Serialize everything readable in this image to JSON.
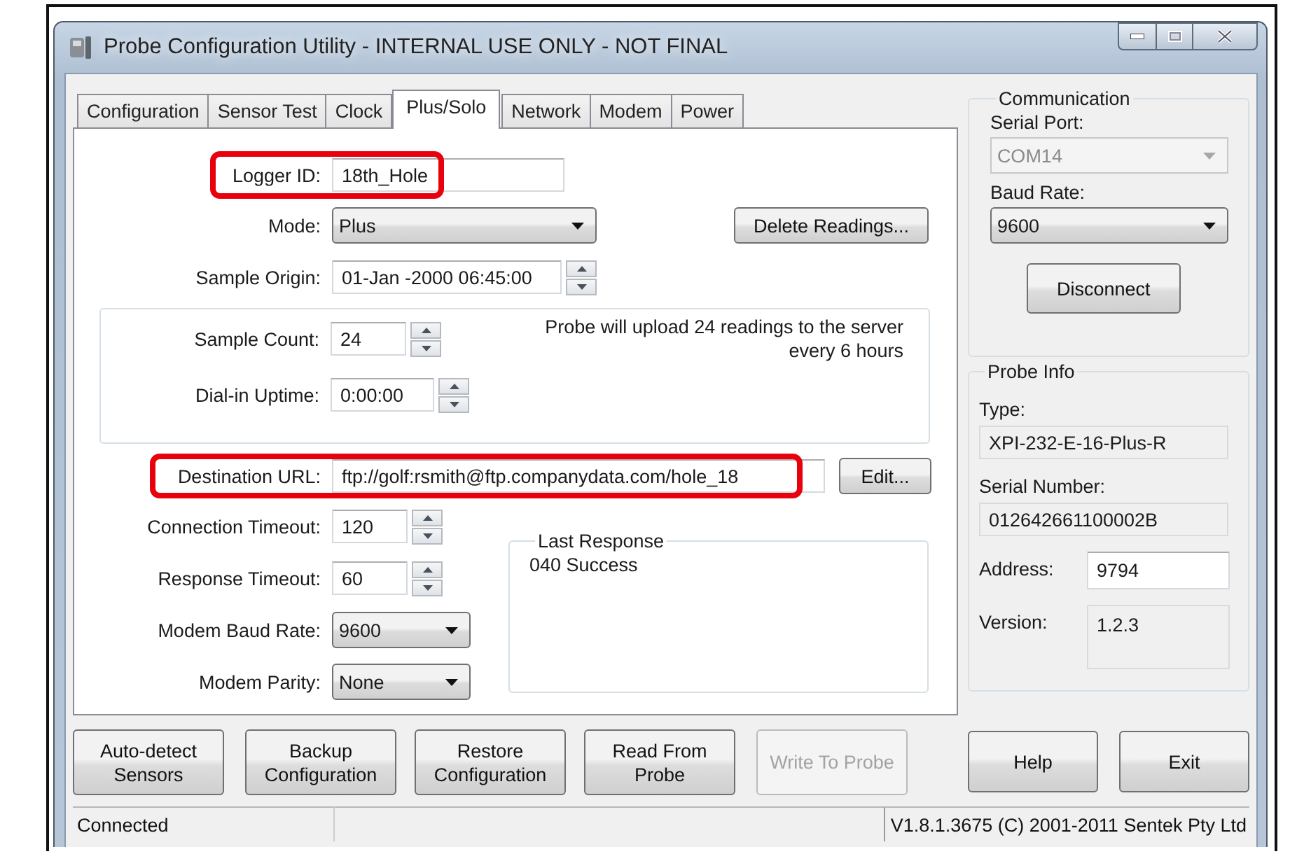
{
  "window": {
    "title": "Probe Configuration Utility - INTERNAL USE ONLY - NOT FINAL"
  },
  "tabs": [
    {
      "label": "Configuration",
      "selected": false
    },
    {
      "label": "Sensor Test",
      "selected": false
    },
    {
      "label": "Clock",
      "selected": false
    },
    {
      "label": "Plus/Solo",
      "selected": true
    },
    {
      "label": "Network",
      "selected": false
    },
    {
      "label": "Modem",
      "selected": false
    },
    {
      "label": "Power",
      "selected": false
    }
  ],
  "plus_solo": {
    "logger_id": {
      "label": "Logger ID:",
      "value": "18th_Hole",
      "highlighted": true
    },
    "mode": {
      "label": "Mode:",
      "value": "Plus"
    },
    "delete_button": "Delete Readings...",
    "sample_origin": {
      "label": "Sample Origin:",
      "value": "01-Jan -2000 06:45:00"
    },
    "sample_count": {
      "label": "Sample Count:",
      "value": "24"
    },
    "dial_in_uptime": {
      "label": "Dial-in Uptime:",
      "value": "0:00:00"
    },
    "upload_note": "Probe will upload 24 readings to the server\nevery 6 hours",
    "destination_url": {
      "label": "Destination URL:",
      "value": "ftp://golf:rsmith@ftp.companydata.com/hole_18",
      "highlighted": true
    },
    "edit_button": "Edit...",
    "modem_settings": [
      {
        "kind": "spin",
        "label": "Connection Timeout:",
        "value": "120"
      },
      {
        "kind": "spin",
        "label": "Response Timeout:",
        "value": "60"
      },
      {
        "kind": "dropdown",
        "label": "Modem Baud Rate:",
        "value": "9600"
      },
      {
        "kind": "dropdown",
        "label": "Modem Parity:",
        "value": "None"
      }
    ],
    "last_response": {
      "title": "Last Response",
      "text": "040 Success"
    }
  },
  "communication": {
    "title": "Communication",
    "serial_port": {
      "label": "Serial Port:",
      "value": "COM14",
      "disabled": true
    },
    "baud_rate": {
      "label": "Baud Rate:",
      "value": "9600",
      "disabled": false
    },
    "disconnect_button": "Disconnect"
  },
  "probe_info": {
    "title": "Probe Info",
    "fields": [
      {
        "kind": "stacked",
        "label": "Type:",
        "value": "XPI-232-E-16-Plus-R",
        "editable": false
      },
      {
        "kind": "stacked",
        "label": "Serial Number:",
        "value": "012642661100002B",
        "editable": false
      },
      {
        "kind": "inline",
        "label": "Address:",
        "value": "9794",
        "editable": true
      },
      {
        "kind": "inline_tall",
        "label": "Version:",
        "value": "1.2.3",
        "editable": false
      }
    ]
  },
  "action_buttons": [
    {
      "label": "Auto-detect\nSensors",
      "disabled": false
    },
    {
      "label": "Backup\nConfiguration",
      "disabled": false
    },
    {
      "label": "Restore\nConfiguration",
      "disabled": false
    },
    {
      "label": "Read From\nProbe",
      "disabled": false
    },
    {
      "label": "Write To Probe",
      "disabled": true
    }
  ],
  "dialog_buttons": [
    "Help",
    "Exit"
  ],
  "status_bar": {
    "status": "Connected",
    "version": "V1.8.1.3675 (C) 2001-2011 Sentek Pty Ltd"
  }
}
